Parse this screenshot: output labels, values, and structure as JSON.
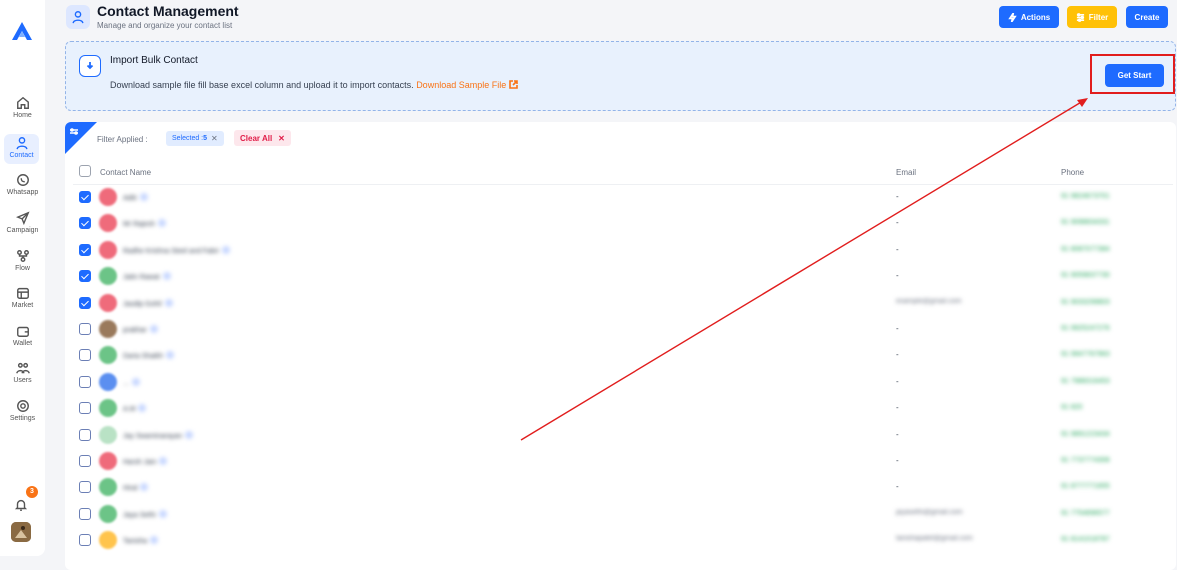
{
  "sidebar": {
    "items": [
      {
        "label": "Home",
        "icon": "home-icon"
      },
      {
        "label": "Contact",
        "icon": "user-icon",
        "active": true
      },
      {
        "label": "Whatsapp",
        "icon": "whatsapp-icon"
      },
      {
        "label": "Campaign",
        "icon": "send-icon"
      },
      {
        "label": "Flow",
        "icon": "flow-icon"
      },
      {
        "label": "Market",
        "icon": "store-icon"
      },
      {
        "label": "Wallet",
        "icon": "wallet-icon"
      },
      {
        "label": "Users",
        "icon": "users-icon"
      },
      {
        "label": "Settings",
        "icon": "settings-icon"
      }
    ],
    "notification_count": "3"
  },
  "header": {
    "title": "Contact Management",
    "subtitle": "Manage and organize your contact list",
    "actions_label": "Actions",
    "filter_label": "Filter",
    "create_label": "Create"
  },
  "import": {
    "title": "Import Bulk Contact",
    "description": "Download sample file fill base excel column and upload it to import contacts.",
    "link": "Download Sample File",
    "button": "Get Start"
  },
  "filters": {
    "label": "Filter Applied :",
    "selected_prefix": "Selected :",
    "selected_count": "5",
    "clear_all": "Clear All"
  },
  "table": {
    "columns": {
      "name": "Contact Name",
      "email": "Email",
      "phone": "Phone"
    },
    "rows": [
      {
        "checked": true,
        "name": "Aditi",
        "email": "-",
        "phone": "91 9824673701",
        "avatar": "#ef6b7b"
      },
      {
        "checked": true,
        "name": "Mr Rajesh",
        "email": "-",
        "phone": "91 9098834331",
        "avatar": "#ef6b7b"
      },
      {
        "checked": true,
        "name": "Radhe Krishna Steel and Fabri",
        "email": "-",
        "phone": "91 8087077384",
        "avatar": "#ef6b7b"
      },
      {
        "checked": true,
        "name": "Jatin Rawat",
        "email": "-",
        "phone": "91 9059837730",
        "avatar": "#6cc487"
      },
      {
        "checked": true,
        "name": "Jasdip Gohil",
        "email": "example@gmail.com",
        "phone": "91 9033299803",
        "avatar": "#ef6b7b"
      },
      {
        "checked": false,
        "name": "prakhar",
        "email": "-",
        "phone": "91 9925247276",
        "avatar": "#9a7a5c"
      },
      {
        "checked": false,
        "name": "Daria Shaikh",
        "email": "-",
        "phone": "91 9947767963",
        "avatar": "#6cc487"
      },
      {
        "checked": false,
        "name": "...",
        "email": "-",
        "phone": "91 7988316453",
        "avatar": "#5b8ff0"
      },
      {
        "checked": false,
        "name": "A.M",
        "email": "-",
        "phone": "91 820",
        "avatar": "#6cc487"
      },
      {
        "checked": false,
        "name": "Jay Swaminarayan",
        "email": "-",
        "phone": "91 9891223434",
        "avatar": "#b9e2c5"
      },
      {
        "checked": false,
        "name": "Harsh Jain",
        "email": "-",
        "phone": "91 7737774308",
        "avatar": "#ef6b7b"
      },
      {
        "checked": false,
        "name": "Hiral",
        "email": "-",
        "phone": "91 8777771655",
        "avatar": "#6cc487"
      },
      {
        "checked": false,
        "name": "Jaya Sethi",
        "email": "jayasethi@gmail.com",
        "phone": "91 7754896577",
        "avatar": "#6cc487"
      },
      {
        "checked": false,
        "name": "Tanisha",
        "email": "tanishapatel@gmail.com",
        "phone": "91 8141018787",
        "avatar": "#ffc44d"
      }
    ]
  },
  "colors": {
    "primary": "#1e6bff",
    "filter": "#ffc107",
    "link": "#f97316",
    "clear": "#e11d48",
    "annotation": "#e11d1d"
  }
}
